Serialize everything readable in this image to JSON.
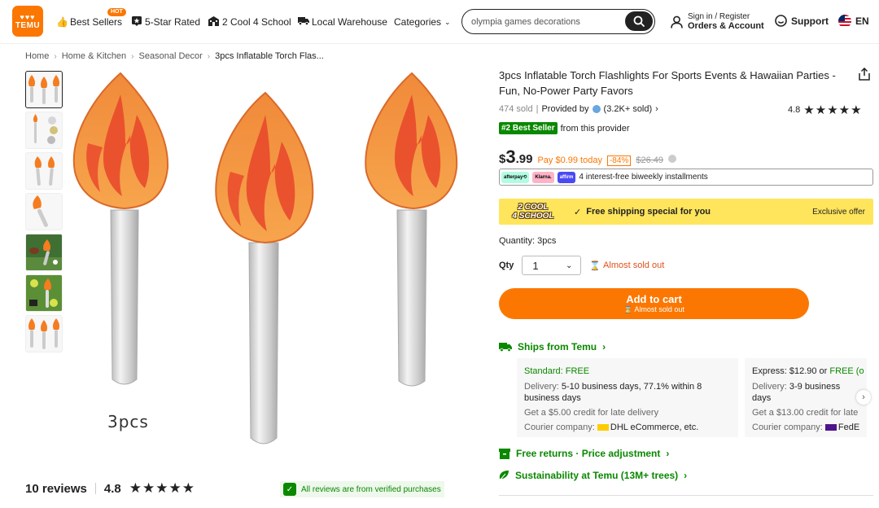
{
  "header": {
    "logo_top": "♥♥♥",
    "logo_word": "TEMU",
    "nav": [
      {
        "label": "Best Sellers",
        "icon": "thumbs-up-icon"
      },
      {
        "label": "5-Star Rated",
        "icon": "star-badge-icon"
      },
      {
        "label": "2 Cool 4 School",
        "icon": "school-icon"
      },
      {
        "label": "Local Warehouse",
        "icon": "truck-icon"
      },
      {
        "label": "Categories",
        "icon": "chevron-down-icon"
      }
    ],
    "hot_badge": "HOT",
    "search_value": "olympia games decorations",
    "account_line1": "Sign in / Register",
    "account_line2": "Orders & Account",
    "support": "Support",
    "language": "EN"
  },
  "breadcrumb": [
    "Home",
    "Home & Kitchen",
    "Seasonal Decor",
    "3pcs Inflatable Torch Flas..."
  ],
  "gallery": {
    "pcs_label": "3pcs"
  },
  "reviews": {
    "count": "10 reviews",
    "rating": "4.8",
    "stars": "★★★★★",
    "verified": "All reviews are from verified purchases"
  },
  "product": {
    "title": "3pcs Inflatable Torch Flashlights For Sports Events & Hawaiian Parties - Fun, No-Power Party Favors",
    "sold": "474 sold",
    "provided_by": "Provided by",
    "provider_sold": "(3.2K+ sold)",
    "rating": "4.8",
    "stars": "★★★★★",
    "best_badge": "#2 Best Seller",
    "best_suffix": "from this provider",
    "price_dollar": "$",
    "price_int": "3",
    "price_dec": ".99",
    "pay_today": "Pay $0.99 today",
    "discount": "-84%",
    "original_price": "$26.49",
    "payment_methods": [
      "afterpay⟲",
      "Klarna.",
      "affirm"
    ],
    "installments": "4 interest-free biweekly installments",
    "promo_logo_1": "2 COOL",
    "promo_logo_2": "4 SCHOOL",
    "promo_check": "✓",
    "promo_text": "Free shipping special for you",
    "promo_exclusive": "Exclusive offer",
    "quantity_label": "Quantity: 3pcs",
    "qty_label": "Qty",
    "qty_value": "1",
    "almost_sold_out": "Almost sold out",
    "add_to_cart": "Add to cart",
    "add_to_cart_sub": "Almost sold out"
  },
  "shipping": {
    "ships_from": "Ships from Temu",
    "standard": {
      "title": "Standard: FREE",
      "delivery_label": "Delivery:",
      "delivery": "5-10 business days, 77.1% within 8 business days",
      "credit": "Get a $5.00 credit for late delivery",
      "courier_label": "Courier company:",
      "courier": "DHL eCommerce, etc."
    },
    "express": {
      "title_prefix": "Express: $12.90 or",
      "title_free": "FREE (o",
      "delivery_label": "Delivery:",
      "delivery": "3-9 business days",
      "credit": "Get a $13.00 credit for late",
      "courier_label": "Courier company:",
      "courier": "FedE"
    },
    "free_returns": "Free returns · Price adjustment",
    "sustainability": "Sustainability at Temu (13M+ trees)"
  },
  "colors": {
    "brand_orange": "#fb7701",
    "green": "#0a8800",
    "promo_yellow": "#ffe55c"
  }
}
